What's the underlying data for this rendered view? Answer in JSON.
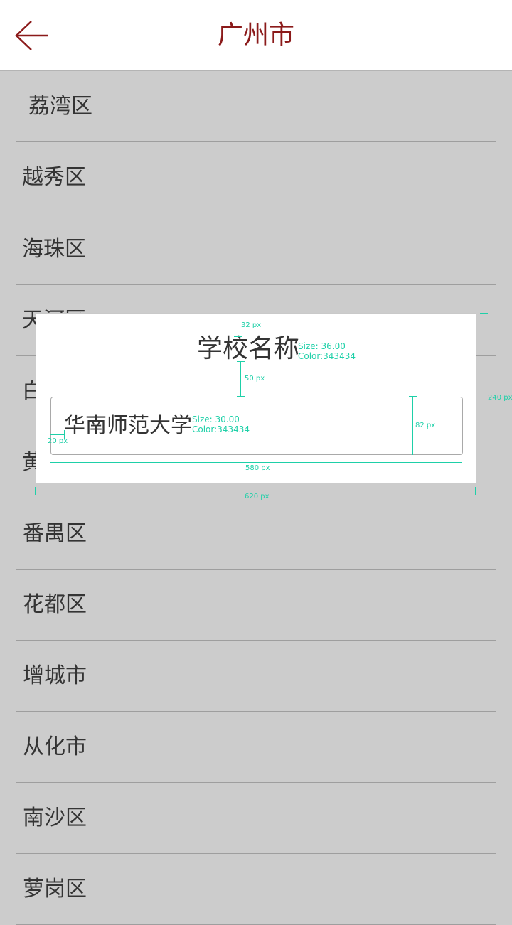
{
  "header": {
    "title": "广州市",
    "back_icon": "arrow-left-icon",
    "accent_color": "#8b1a1a"
  },
  "districts": [
    "荔湾区",
    "越秀区",
    "海珠区",
    "天河区",
    "白云区",
    "黄埔区",
    "番禺区",
    "花都区",
    "增城市",
    "从化市",
    "南沙区",
    "萝岗区"
  ],
  "annotation": {
    "title": "学校名称",
    "title_spec_size": "Size: 36.00",
    "title_spec_color": "Color:343434",
    "field_text": "华南师范大学",
    "field_spec_size": "Size: 30.00",
    "field_spec_color": "Color:343434",
    "dim_top": "32 px",
    "dim_gap": "50 px",
    "dim_field_height": "82 px",
    "dim_left_pad": "20 px",
    "dim_field_width": "580 px",
    "dim_card_width": "620 px",
    "dim_card_height": "240 px",
    "spec_color": "#1ed0a8"
  }
}
